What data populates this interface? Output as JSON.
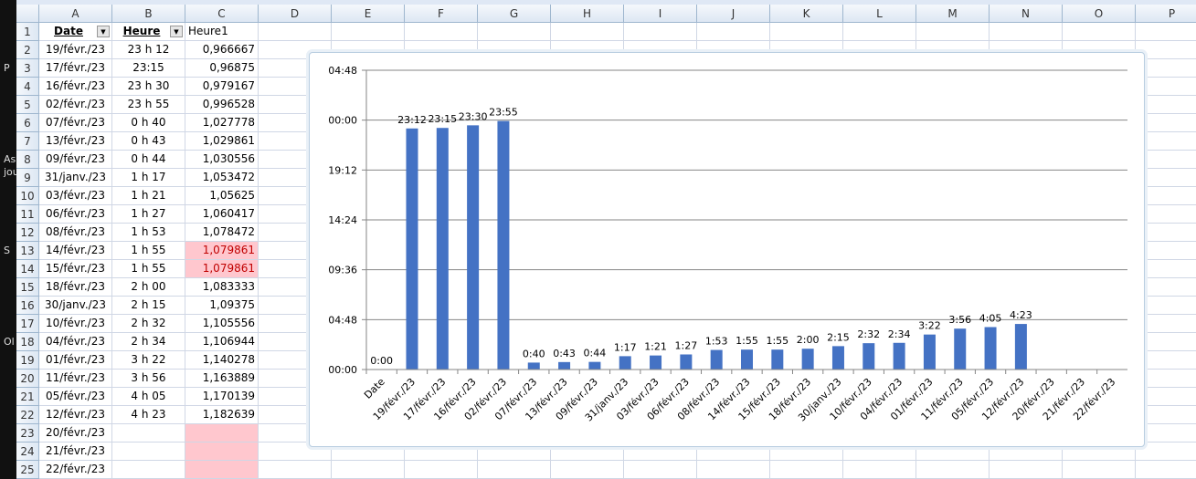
{
  "columns": [
    "A",
    "B",
    "C",
    "D",
    "E",
    "F",
    "G",
    "H",
    "I",
    "J",
    "K",
    "L",
    "M",
    "N",
    "O",
    "P"
  ],
  "header_row": {
    "date": "Date",
    "heure": "Heure",
    "heure1": "Heure1"
  },
  "rows": [
    [
      "19/févr./23",
      "23 h 12",
      "0,966667"
    ],
    [
      "17/févr./23",
      "23:15",
      "0,96875"
    ],
    [
      "16/févr./23",
      "23 h 30",
      "0,979167"
    ],
    [
      "02/févr./23",
      "23 h 55",
      "0,996528"
    ],
    [
      "07/févr./23",
      "0 h 40",
      "1,027778"
    ],
    [
      "13/févr./23",
      "0 h 43",
      "1,029861"
    ],
    [
      "09/févr./23",
      "0 h 44",
      "1,030556"
    ],
    [
      "31/janv./23",
      "1 h 17",
      "1,053472"
    ],
    [
      "03/févr./23",
      "1 h 21",
      "1,05625"
    ],
    [
      "06/févr./23",
      "1 h 27",
      "1,060417"
    ],
    [
      "08/févr./23",
      "1 h 53",
      "1,078472"
    ],
    [
      "14/févr./23",
      "1 h 55",
      "1,079861"
    ],
    [
      "15/févr./23",
      "1 h 55",
      "1,079861"
    ],
    [
      "18/févr./23",
      "2 h 00",
      "1,083333"
    ],
    [
      "30/janv./23",
      "2 h 15",
      "1,09375"
    ],
    [
      "10/févr./23",
      "2 h 32",
      "1,105556"
    ],
    [
      "04/févr./23",
      "2 h 34",
      "1,106944"
    ],
    [
      "01/févr./23",
      "3 h 22",
      "1,140278"
    ],
    [
      "11/févr./23",
      "3 h 56",
      "1,163889"
    ],
    [
      "05/févr./23",
      "4 h 05",
      "1,170139"
    ],
    [
      "12/févr./23",
      "4 h 23",
      "1,182639"
    ],
    [
      "20/févr./23",
      "",
      ""
    ],
    [
      "21/févr./23",
      "",
      ""
    ],
    [
      "22/févr./23",
      "",
      ""
    ]
  ],
  "behind_window_text": [
    "P",
    "As",
    "jou",
    "S",
    "Ol"
  ],
  "chart_data": {
    "type": "bar",
    "color": "#4472c4",
    "categories": [
      "Date",
      "19/févr./23",
      "17/févr./23",
      "16/févr./23",
      "02/févr./23",
      "07/févr./23",
      "13/févr./23",
      "09/févr./23",
      "31/janv./23",
      "03/févr./23",
      "06/févr./23",
      "08/févr./23",
      "14/févr./23",
      "15/févr./23",
      "18/févr./23",
      "30/janv./23",
      "10/févr./23",
      "04/févr./23",
      "01/févr./23",
      "11/févr./23",
      "05/févr./23",
      "12/févr./23",
      "20/févr./23",
      "21/févr./23",
      "22/févr./23"
    ],
    "values": [
      0,
      0.966667,
      0.96875,
      0.979167,
      0.996528,
      0.027778,
      0.029861,
      0.030556,
      0.053472,
      0.05625,
      0.060417,
      0.078472,
      0.079861,
      0.079861,
      0.083333,
      0.09375,
      0.105556,
      0.106944,
      0.140278,
      0.163889,
      0.170139,
      0.182639,
      null,
      null,
      null
    ],
    "data_labels": [
      "0:00",
      "23:12",
      "23:15",
      "23:30",
      "23:55",
      "0:40",
      "0:43",
      "0:44",
      "1:17",
      "1:21",
      "1:27",
      "1:53",
      "1:55",
      "1:55",
      "2:00",
      "2:15",
      "2:32",
      "2:34",
      "3:22",
      "3:56",
      "4:05",
      "4:23",
      "",
      "",
      ""
    ],
    "ylim": [
      0,
      1.2
    ],
    "y_ticks": [
      "00:00",
      "04:48",
      "09:36",
      "14:24",
      "19:12",
      "00:00",
      "04:48"
    ],
    "grid": true
  }
}
